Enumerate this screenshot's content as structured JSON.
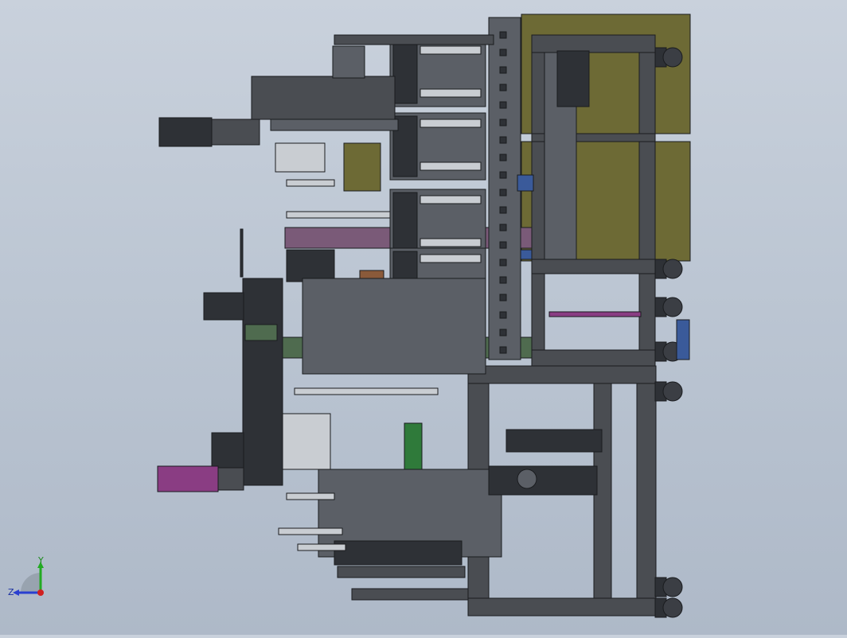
{
  "viewport": {
    "background_top": "#c9d1dc",
    "background_bottom": "#aeb9c8"
  },
  "model": {
    "colors": {
      "frame": "#4a4d52",
      "frame_edge": "#1a1c1f",
      "steel": "#5b5f66",
      "dark": "#2e3136",
      "olive": "#6d6a35",
      "purple_bar": "#7a5a78",
      "green_bar": "#4f6b4f",
      "magenta_motor": "#8a3d83",
      "light_part": "#c9cdd2",
      "wheel": "#3b3e44",
      "blue_part": "#3a5a9a",
      "copper": "#8a5a3a",
      "bright_green": "#2f7a3a"
    }
  },
  "triad": {
    "y_label": "Y",
    "z_label": "Z",
    "y_color": "#22aa22",
    "z_color": "#2a3fd0",
    "x_color": "#d02020"
  }
}
